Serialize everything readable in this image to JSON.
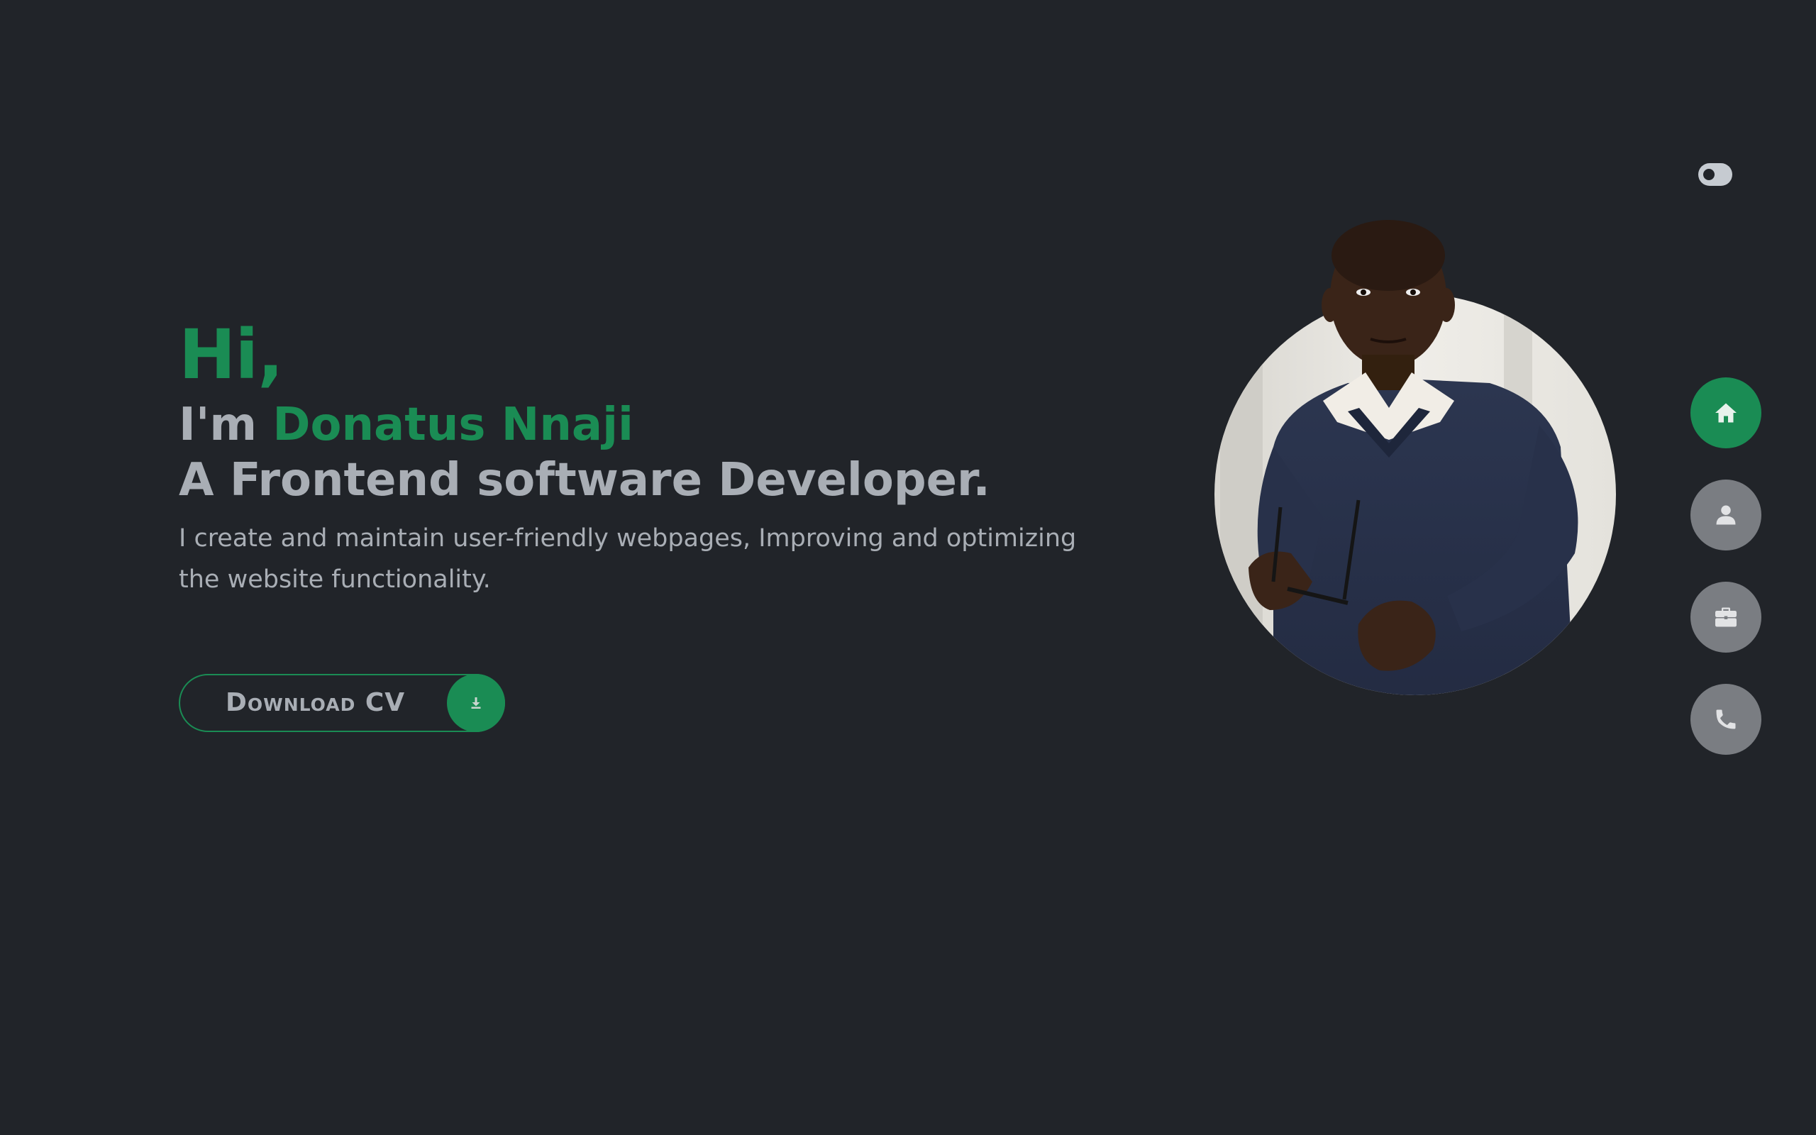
{
  "hero": {
    "greeting": "Hi,",
    "intro_prefix": "I'm",
    "name": "Donatus Nnaji",
    "role": "A Frontend software Developer.",
    "description": "I create and maintain user-friendly webpages, Improving and optimizing the website functionality."
  },
  "cta": {
    "download_label": "Download CV",
    "download_icon": "download-icon"
  },
  "theme_toggle": {
    "icon": "toggle-icon"
  },
  "nav": {
    "items": [
      {
        "icon": "home-icon",
        "active": true
      },
      {
        "icon": "user-icon",
        "active": false
      },
      {
        "icon": "briefcase-icon",
        "active": false
      },
      {
        "icon": "phone-icon",
        "active": false
      }
    ]
  },
  "colors": {
    "background": "#212429",
    "accent": "#1a8c54",
    "text": "#a9aeb5",
    "nav_inactive": "#7a7d82"
  }
}
